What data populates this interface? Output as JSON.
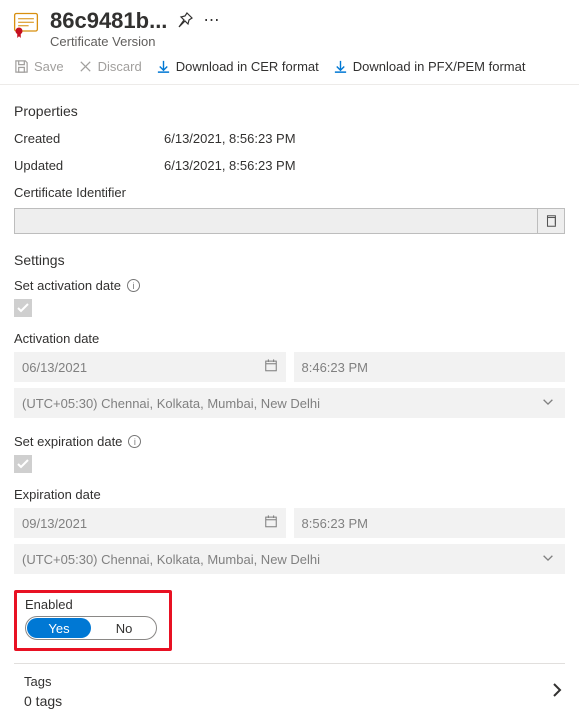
{
  "header": {
    "title": "86c9481b...",
    "subtitle": "Certificate Version"
  },
  "toolbar": {
    "save": "Save",
    "discard": "Discard",
    "download_cer": "Download in CER format",
    "download_pfx": "Download in PFX/PEM format"
  },
  "properties": {
    "title": "Properties",
    "created_label": "Created",
    "created_value": "6/13/2021, 8:56:23 PM",
    "updated_label": "Updated",
    "updated_value": "6/13/2021, 8:56:23 PM",
    "identifier_label": "Certificate Identifier",
    "identifier_value": ""
  },
  "settings": {
    "title": "Settings",
    "activation_label": "Set activation date",
    "activation_date_label": "Activation date",
    "activation_date": "06/13/2021",
    "activation_time": "8:46:23 PM",
    "activation_tz": "(UTC+05:30) Chennai, Kolkata, Mumbai, New Delhi",
    "expiration_label": "Set expiration date",
    "expiration_date_label": "Expiration date",
    "expiration_date": "09/13/2021",
    "expiration_time": "8:56:23 PM",
    "expiration_tz": "(UTC+05:30) Chennai, Kolkata, Mumbai, New Delhi"
  },
  "enabled": {
    "label": "Enabled",
    "yes": "Yes",
    "no": "No"
  },
  "tags": {
    "label": "Tags",
    "count": "0 tags"
  }
}
